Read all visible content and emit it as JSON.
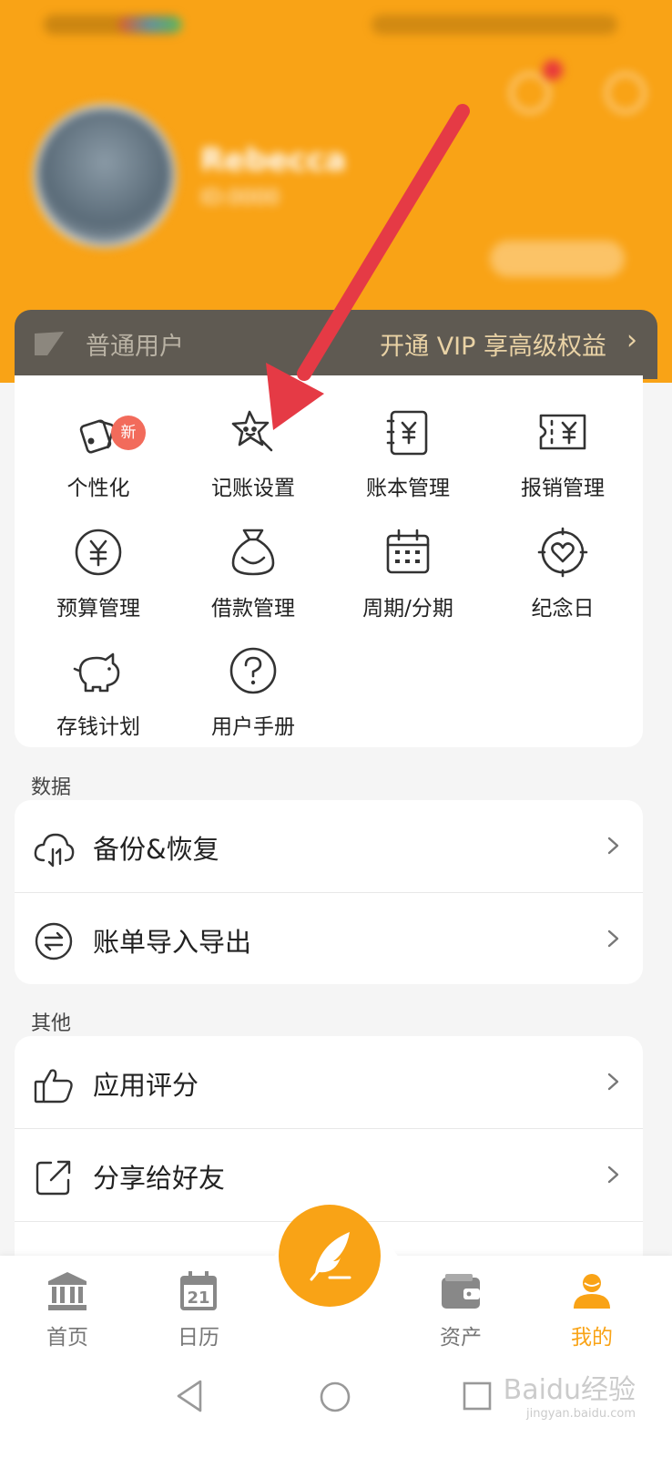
{
  "colors": {
    "accent": "#f9a316",
    "vip_bar": "#5f5a52",
    "badge": "#f26b5b",
    "annotation_arrow": "#e53a45"
  },
  "header": {
    "username": "Rebecca",
    "user_id": "ID:0000"
  },
  "vip": {
    "level": "普通用户",
    "promo": "开通 VIP 享高级权益",
    "chevron": "›"
  },
  "grid": {
    "items": [
      {
        "label": "个性化",
        "icon": "personalize-icon",
        "badge": "新"
      },
      {
        "label": "记账设置",
        "icon": "star-face-icon"
      },
      {
        "label": "账本管理",
        "icon": "ledger-icon"
      },
      {
        "label": "报销管理",
        "icon": "reimburse-ticket-icon"
      },
      {
        "label": "预算管理",
        "icon": "yen-circle-icon"
      },
      {
        "label": "借款管理",
        "icon": "money-bag-icon"
      },
      {
        "label": "周期/分期",
        "icon": "calendar-grid-icon"
      },
      {
        "label": "纪念日",
        "icon": "heart-target-icon"
      },
      {
        "label": "存钱计划",
        "icon": "piggy-bank-icon"
      },
      {
        "label": "用户手册",
        "icon": "question-circle-icon"
      }
    ]
  },
  "sections": {
    "data_title": "数据",
    "data_rows": [
      {
        "label": "备份&恢复",
        "icon": "cloud-sync-icon"
      },
      {
        "label": "账单导入导出",
        "icon": "import-export-icon"
      }
    ],
    "other_title": "其他",
    "other_rows": [
      {
        "label": "应用评分",
        "icon": "thumbs-up-icon"
      },
      {
        "label": "分享给好友",
        "icon": "share-icon"
      }
    ]
  },
  "tabbar": {
    "tabs": [
      {
        "label": "首页",
        "icon": "bank-icon"
      },
      {
        "label": "日历",
        "icon": "calendar-icon",
        "date": "21"
      },
      {
        "label": "资产",
        "icon": "wallet-icon"
      },
      {
        "label": "我的",
        "icon": "user-icon",
        "active": true
      }
    ],
    "fab_icon": "quill-icon"
  },
  "watermark": {
    "text": "Baidu经验",
    "sub": "jingyan.baidu.com"
  }
}
